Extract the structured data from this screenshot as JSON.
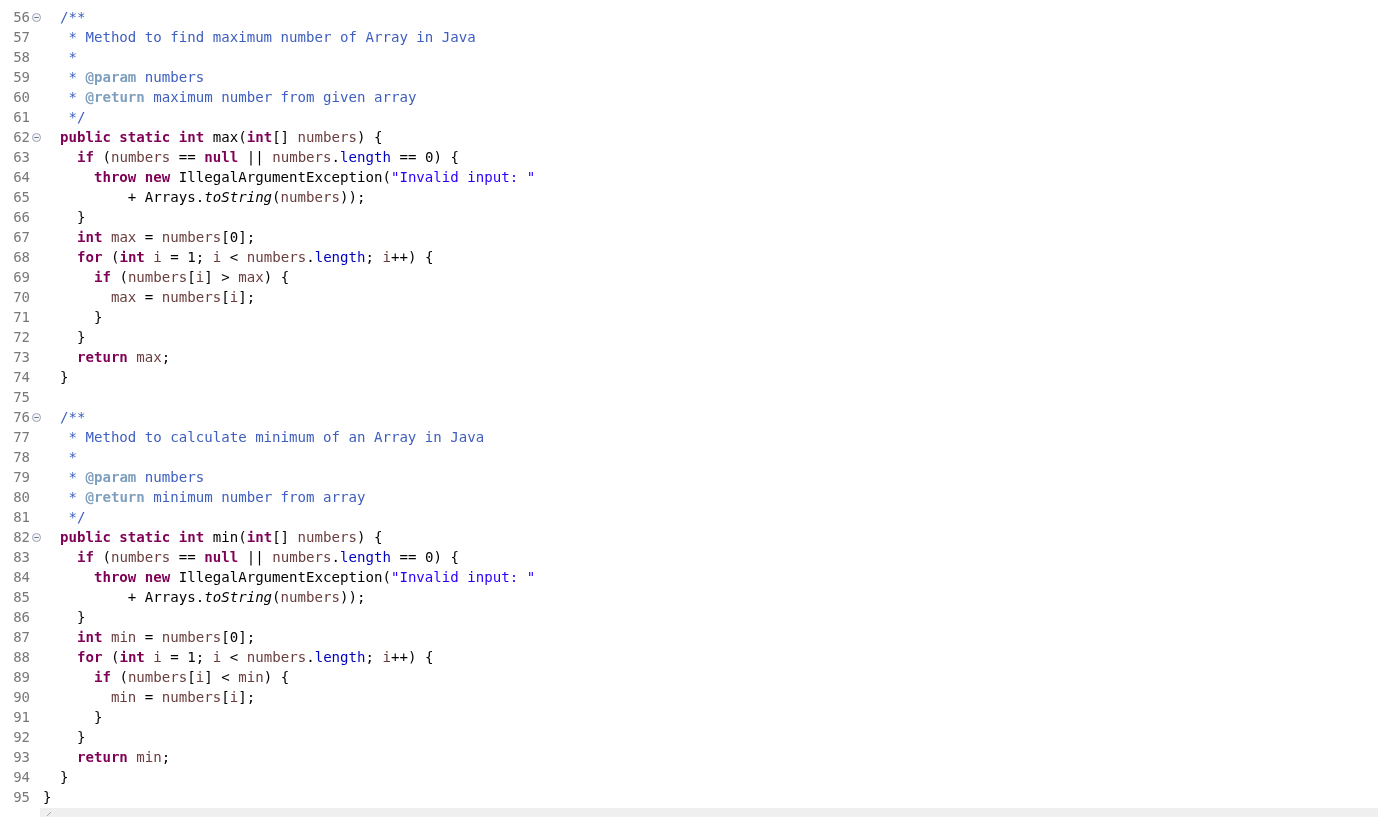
{
  "editor": {
    "lines": [
      {
        "number": "56",
        "fold": true,
        "tokens": [
          {
            "kind": "cm",
            "text": "  /**"
          }
        ]
      },
      {
        "number": "57",
        "fold": false,
        "tokens": [
          {
            "kind": "cm",
            "text": "   * Method to find maximum number of Array in Java"
          }
        ]
      },
      {
        "number": "58",
        "fold": false,
        "tokens": [
          {
            "kind": "cm",
            "text": "   *"
          }
        ]
      },
      {
        "number": "59",
        "fold": false,
        "tokens": [
          {
            "kind": "cm",
            "text": "   * "
          },
          {
            "kind": "tag",
            "text": "@param"
          },
          {
            "kind": "cm",
            "text": " numbers"
          }
        ]
      },
      {
        "number": "60",
        "fold": false,
        "tokens": [
          {
            "kind": "cm",
            "text": "   * "
          },
          {
            "kind": "tag",
            "text": "@return"
          },
          {
            "kind": "cm",
            "text": " maximum number from given array"
          }
        ]
      },
      {
        "number": "61",
        "fold": false,
        "tokens": [
          {
            "kind": "cm",
            "text": "   */"
          }
        ]
      },
      {
        "number": "62",
        "fold": true,
        "tokens": [
          {
            "kind": "kw",
            "text": "  public static int"
          },
          {
            "kind": "txt",
            "text": " max("
          },
          {
            "kind": "kw",
            "text": "int"
          },
          {
            "kind": "txt",
            "text": "[] "
          },
          {
            "kind": "var",
            "text": "numbers"
          },
          {
            "kind": "txt",
            "text": ") {"
          }
        ]
      },
      {
        "number": "63",
        "fold": false,
        "tokens": [
          {
            "kind": "kw",
            "text": "    if"
          },
          {
            "kind": "txt",
            "text": " ("
          },
          {
            "kind": "var",
            "text": "numbers"
          },
          {
            "kind": "txt",
            "text": " == "
          },
          {
            "kind": "kw",
            "text": "null"
          },
          {
            "kind": "txt",
            "text": " || "
          },
          {
            "kind": "var",
            "text": "numbers"
          },
          {
            "kind": "txt",
            "text": "."
          },
          {
            "kind": "fld",
            "text": "length"
          },
          {
            "kind": "txt",
            "text": " == 0) {"
          }
        ]
      },
      {
        "number": "64",
        "fold": false,
        "tokens": [
          {
            "kind": "kw",
            "text": "      throw new"
          },
          {
            "kind": "txt",
            "text": " IllegalArgumentException("
          },
          {
            "kind": "str",
            "text": "\"Invalid input: \""
          }
        ]
      },
      {
        "number": "65",
        "fold": false,
        "tokens": [
          {
            "kind": "txt",
            "text": "          + Arrays."
          },
          {
            "kind": "ital",
            "text": "toString"
          },
          {
            "kind": "txt",
            "text": "("
          },
          {
            "kind": "var",
            "text": "numbers"
          },
          {
            "kind": "txt",
            "text": "));"
          }
        ]
      },
      {
        "number": "66",
        "fold": false,
        "tokens": [
          {
            "kind": "txt",
            "text": "    }"
          }
        ]
      },
      {
        "number": "67",
        "fold": false,
        "tokens": [
          {
            "kind": "kw",
            "text": "    int "
          },
          {
            "kind": "var",
            "text": "max"
          },
          {
            "kind": "txt",
            "text": " = "
          },
          {
            "kind": "var",
            "text": "numbers"
          },
          {
            "kind": "txt",
            "text": "[0];"
          }
        ]
      },
      {
        "number": "68",
        "fold": false,
        "tokens": [
          {
            "kind": "kw",
            "text": "    for"
          },
          {
            "kind": "txt",
            "text": " ("
          },
          {
            "kind": "kw",
            "text": "int "
          },
          {
            "kind": "var",
            "text": "i"
          },
          {
            "kind": "txt",
            "text": " = 1; "
          },
          {
            "kind": "var",
            "text": "i"
          },
          {
            "kind": "txt",
            "text": " < "
          },
          {
            "kind": "var",
            "text": "numbers"
          },
          {
            "kind": "txt",
            "text": "."
          },
          {
            "kind": "fld",
            "text": "length"
          },
          {
            "kind": "txt",
            "text": "; "
          },
          {
            "kind": "var",
            "text": "i"
          },
          {
            "kind": "txt",
            "text": "++) {"
          }
        ]
      },
      {
        "number": "69",
        "fold": false,
        "tokens": [
          {
            "kind": "kw",
            "text": "      if"
          },
          {
            "kind": "txt",
            "text": " ("
          },
          {
            "kind": "var",
            "text": "numbers"
          },
          {
            "kind": "txt",
            "text": "["
          },
          {
            "kind": "var",
            "text": "i"
          },
          {
            "kind": "txt",
            "text": "] > "
          },
          {
            "kind": "var",
            "text": "max"
          },
          {
            "kind": "txt",
            "text": ") {"
          }
        ]
      },
      {
        "number": "70",
        "fold": false,
        "tokens": [
          {
            "kind": "var",
            "text": "        max"
          },
          {
            "kind": "txt",
            "text": " = "
          },
          {
            "kind": "var",
            "text": "numbers"
          },
          {
            "kind": "txt",
            "text": "["
          },
          {
            "kind": "var",
            "text": "i"
          },
          {
            "kind": "txt",
            "text": "];"
          }
        ]
      },
      {
        "number": "71",
        "fold": false,
        "tokens": [
          {
            "kind": "txt",
            "text": "      }"
          }
        ]
      },
      {
        "number": "72",
        "fold": false,
        "tokens": [
          {
            "kind": "txt",
            "text": "    }"
          }
        ]
      },
      {
        "number": "73",
        "fold": false,
        "tokens": [
          {
            "kind": "kw",
            "text": "    return "
          },
          {
            "kind": "var",
            "text": "max"
          },
          {
            "kind": "txt",
            "text": ";"
          }
        ]
      },
      {
        "number": "74",
        "fold": false,
        "tokens": [
          {
            "kind": "txt",
            "text": "  }"
          }
        ]
      },
      {
        "number": "75",
        "fold": false
      },
      {
        "number": "76",
        "fold": true,
        "tokens": [
          {
            "kind": "cm",
            "text": "  /**"
          }
        ]
      },
      {
        "number": "77",
        "fold": false,
        "tokens": [
          {
            "kind": "cm",
            "text": "   * Method to calculate minimum of an Array in Java"
          }
        ]
      },
      {
        "number": "78",
        "fold": false,
        "tokens": [
          {
            "kind": "cm",
            "text": "   *"
          }
        ]
      },
      {
        "number": "79",
        "fold": false,
        "tokens": [
          {
            "kind": "cm",
            "text": "   * "
          },
          {
            "kind": "tag",
            "text": "@param"
          },
          {
            "kind": "cm",
            "text": " numbers"
          }
        ]
      },
      {
        "number": "80",
        "fold": false,
        "tokens": [
          {
            "kind": "cm",
            "text": "   * "
          },
          {
            "kind": "tag",
            "text": "@return"
          },
          {
            "kind": "cm",
            "text": " minimum number from array"
          }
        ]
      },
      {
        "number": "81",
        "fold": false,
        "tokens": [
          {
            "kind": "cm",
            "text": "   */"
          }
        ]
      },
      {
        "number": "82",
        "fold": true,
        "tokens": [
          {
            "kind": "kw",
            "text": "  public static int"
          },
          {
            "kind": "txt",
            "text": " min("
          },
          {
            "kind": "kw",
            "text": "int"
          },
          {
            "kind": "txt",
            "text": "[] "
          },
          {
            "kind": "var",
            "text": "numbers"
          },
          {
            "kind": "txt",
            "text": ") {"
          }
        ]
      },
      {
        "number": "83",
        "fold": false,
        "tokens": [
          {
            "kind": "kw",
            "text": "    if"
          },
          {
            "kind": "txt",
            "text": " ("
          },
          {
            "kind": "var",
            "text": "numbers"
          },
          {
            "kind": "txt",
            "text": " == "
          },
          {
            "kind": "kw",
            "text": "null"
          },
          {
            "kind": "txt",
            "text": " || "
          },
          {
            "kind": "var",
            "text": "numbers"
          },
          {
            "kind": "txt",
            "text": "."
          },
          {
            "kind": "fld",
            "text": "length"
          },
          {
            "kind": "txt",
            "text": " == 0) {"
          }
        ]
      },
      {
        "number": "84",
        "fold": false,
        "tokens": [
          {
            "kind": "kw",
            "text": "      throw new"
          },
          {
            "kind": "txt",
            "text": " IllegalArgumentException("
          },
          {
            "kind": "str",
            "text": "\"Invalid input: \""
          }
        ]
      },
      {
        "number": "85",
        "fold": false,
        "tokens": [
          {
            "kind": "txt",
            "text": "          + Arrays."
          },
          {
            "kind": "ital",
            "text": "toString"
          },
          {
            "kind": "txt",
            "text": "("
          },
          {
            "kind": "var",
            "text": "numbers"
          },
          {
            "kind": "txt",
            "text": "));"
          }
        ]
      },
      {
        "number": "86",
        "fold": false,
        "tokens": [
          {
            "kind": "txt",
            "text": "    }"
          }
        ]
      },
      {
        "number": "87",
        "fold": false,
        "tokens": [
          {
            "kind": "kw",
            "text": "    int "
          },
          {
            "kind": "var",
            "text": "min"
          },
          {
            "kind": "txt",
            "text": " = "
          },
          {
            "kind": "var",
            "text": "numbers"
          },
          {
            "kind": "txt",
            "text": "[0];"
          }
        ]
      },
      {
        "number": "88",
        "fold": false,
        "tokens": [
          {
            "kind": "kw",
            "text": "    for"
          },
          {
            "kind": "txt",
            "text": " ("
          },
          {
            "kind": "kw",
            "text": "int "
          },
          {
            "kind": "var",
            "text": "i"
          },
          {
            "kind": "txt",
            "text": " = 1; "
          },
          {
            "kind": "var",
            "text": "i"
          },
          {
            "kind": "txt",
            "text": " < "
          },
          {
            "kind": "var",
            "text": "numbers"
          },
          {
            "kind": "txt",
            "text": "."
          },
          {
            "kind": "fld",
            "text": "length"
          },
          {
            "kind": "txt",
            "text": "; "
          },
          {
            "kind": "var",
            "text": "i"
          },
          {
            "kind": "txt",
            "text": "++) {"
          }
        ]
      },
      {
        "number": "89",
        "fold": false,
        "tokens": [
          {
            "kind": "kw",
            "text": "      if"
          },
          {
            "kind": "txt",
            "text": " ("
          },
          {
            "kind": "var",
            "text": "numbers"
          },
          {
            "kind": "txt",
            "text": "["
          },
          {
            "kind": "var",
            "text": "i"
          },
          {
            "kind": "txt",
            "text": "] < "
          },
          {
            "kind": "var",
            "text": "min"
          },
          {
            "kind": "txt",
            "text": ") {"
          }
        ]
      },
      {
        "number": "90",
        "fold": false,
        "tokens": [
          {
            "kind": "var",
            "text": "        min"
          },
          {
            "kind": "txt",
            "text": " = "
          },
          {
            "kind": "var",
            "text": "numbers"
          },
          {
            "kind": "txt",
            "text": "["
          },
          {
            "kind": "var",
            "text": "i"
          },
          {
            "kind": "txt",
            "text": "];"
          }
        ]
      },
      {
        "number": "91",
        "fold": false,
        "tokens": [
          {
            "kind": "txt",
            "text": "      }"
          }
        ]
      },
      {
        "number": "92",
        "fold": false,
        "tokens": [
          {
            "kind": "txt",
            "text": "    }"
          }
        ]
      },
      {
        "number": "93",
        "fold": false,
        "tokens": [
          {
            "kind": "kw",
            "text": "    return "
          },
          {
            "kind": "var",
            "text": "min"
          },
          {
            "kind": "txt",
            "text": ";"
          }
        ]
      },
      {
        "number": "94",
        "fold": false,
        "tokens": [
          {
            "kind": "txt",
            "text": "  }"
          }
        ]
      },
      {
        "number": "95",
        "fold": false,
        "tokens": [
          {
            "kind": "txt",
            "text": "}"
          }
        ]
      }
    ]
  }
}
